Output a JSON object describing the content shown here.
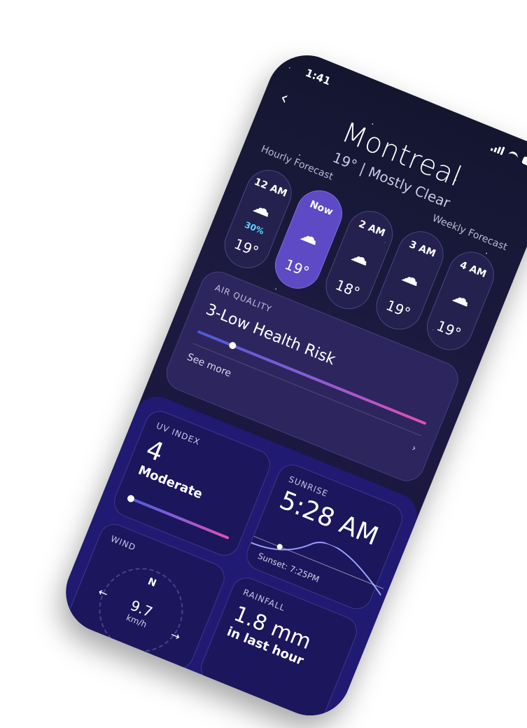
{
  "status_bar": {
    "time": "1:41"
  },
  "header": {
    "back_label": "‹",
    "city": "Montreal",
    "condition": "19° | Mostly Clear"
  },
  "tabs": {
    "hourly": "Hourly Forecast",
    "weekly": "Weekly Forecast"
  },
  "hourly": [
    {
      "hour": "12 AM",
      "precip": "30%",
      "temp": "19°",
      "icon": "rain-cloud"
    },
    {
      "hour": "Now",
      "precip": "",
      "temp": "19°",
      "icon": "rain-cloud"
    },
    {
      "hour": "2 AM",
      "precip": "",
      "temp": "18°",
      "icon": "wind-cloud"
    },
    {
      "hour": "3 AM",
      "precip": "",
      "temp": "19°",
      "icon": "rain-cloud"
    },
    {
      "hour": "4 AM",
      "precip": "",
      "temp": "19°",
      "icon": "rain-cloud"
    }
  ],
  "air_quality": {
    "label": "AIR QUALITY",
    "value": "3-Low Health Risk",
    "see_more": "See more"
  },
  "uv_index": {
    "label": "UV INDEX",
    "value": "4",
    "description": "Moderate"
  },
  "sunrise": {
    "label": "SUNRISE",
    "time": "5:28 AM",
    "sunset": "Sunset: 7:25PM"
  },
  "wind": {
    "label": "WIND",
    "direction": "N",
    "speed": "9.7",
    "unit": "km/h"
  },
  "rainfall": {
    "label": "RAINFALL",
    "value": "1.8 mm",
    "period": "in last hour"
  }
}
